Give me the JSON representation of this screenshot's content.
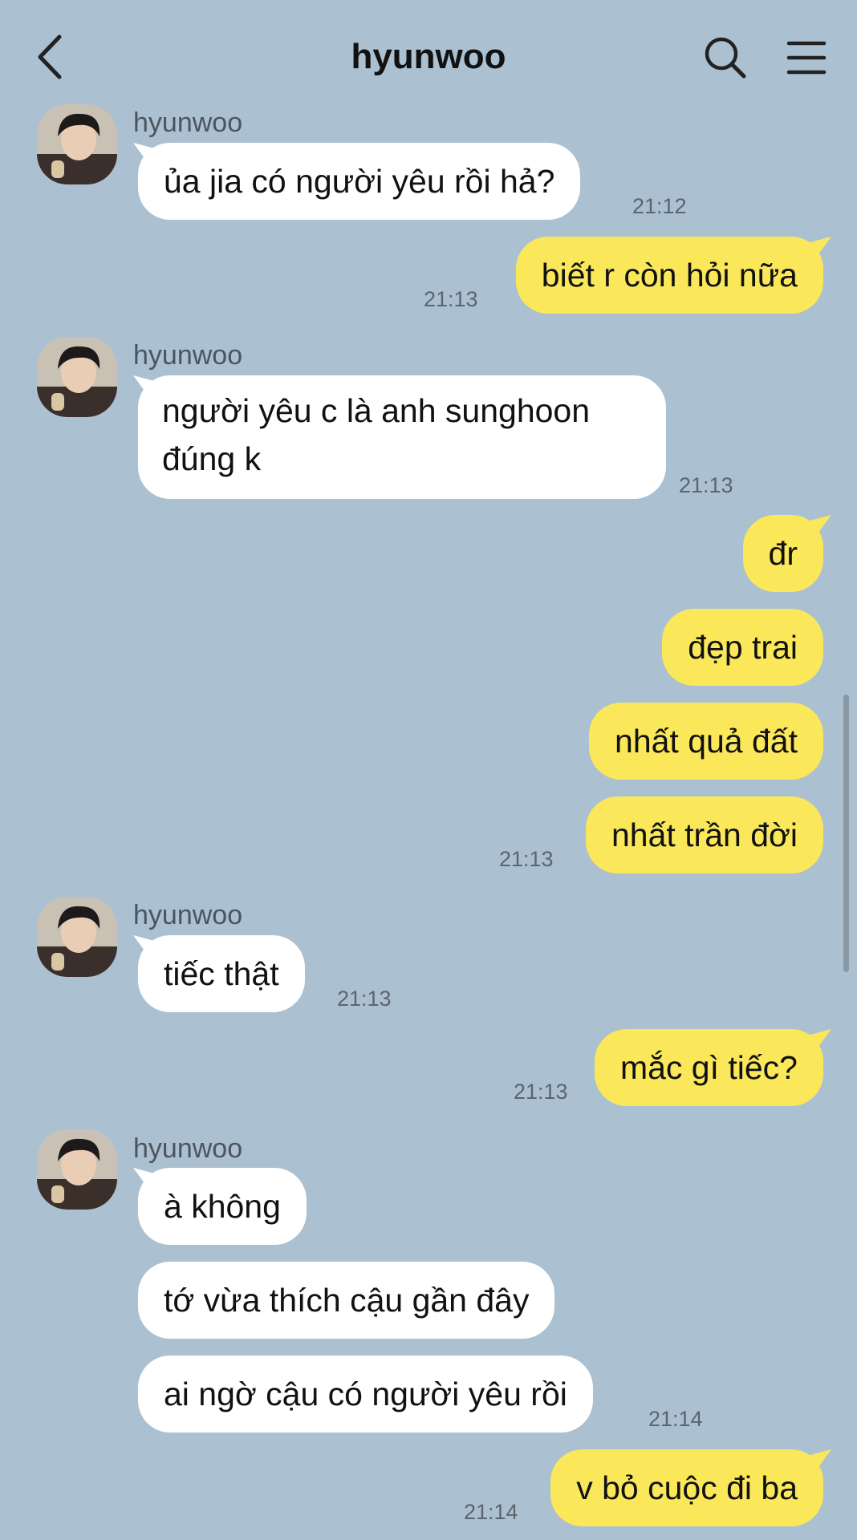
{
  "header": {
    "title": "hyunwoo",
    "back_icon": "chevron-left-icon",
    "search_icon": "search-icon",
    "menu_icon": "hamburger-menu-icon"
  },
  "colors": {
    "background": "#abc1d1",
    "incoming_bubble": "#ffffff",
    "outgoing_bubble": "#fbe85a"
  },
  "messages": [
    {
      "sender": "hyunwoo",
      "text": "ủa jia có người yêu rồi hả?",
      "time": "21:12"
    },
    {
      "text": "biết r còn hỏi nữa",
      "time": "21:13"
    },
    {
      "sender": "hyunwoo",
      "text": "người yêu c là anh sunghoon đúng k",
      "time": "21:13"
    },
    {
      "text": "đr"
    },
    {
      "text": "đẹp trai"
    },
    {
      "text": "nhất quả đất"
    },
    {
      "text": "nhất trần đời",
      "time": "21:13"
    },
    {
      "sender": "hyunwoo",
      "text": "tiếc thật",
      "time": "21:13"
    },
    {
      "text": "mắc gì tiếc?",
      "time": "21:13"
    },
    {
      "sender": "hyunwoo",
      "text": "à không"
    },
    {
      "text": "tớ vừa thích cậu gần đây"
    },
    {
      "text": "ai ngờ cậu có người yêu rồi",
      "time": "21:14"
    },
    {
      "text": "v bỏ cuộc đi ba",
      "time": "21:14"
    }
  ]
}
